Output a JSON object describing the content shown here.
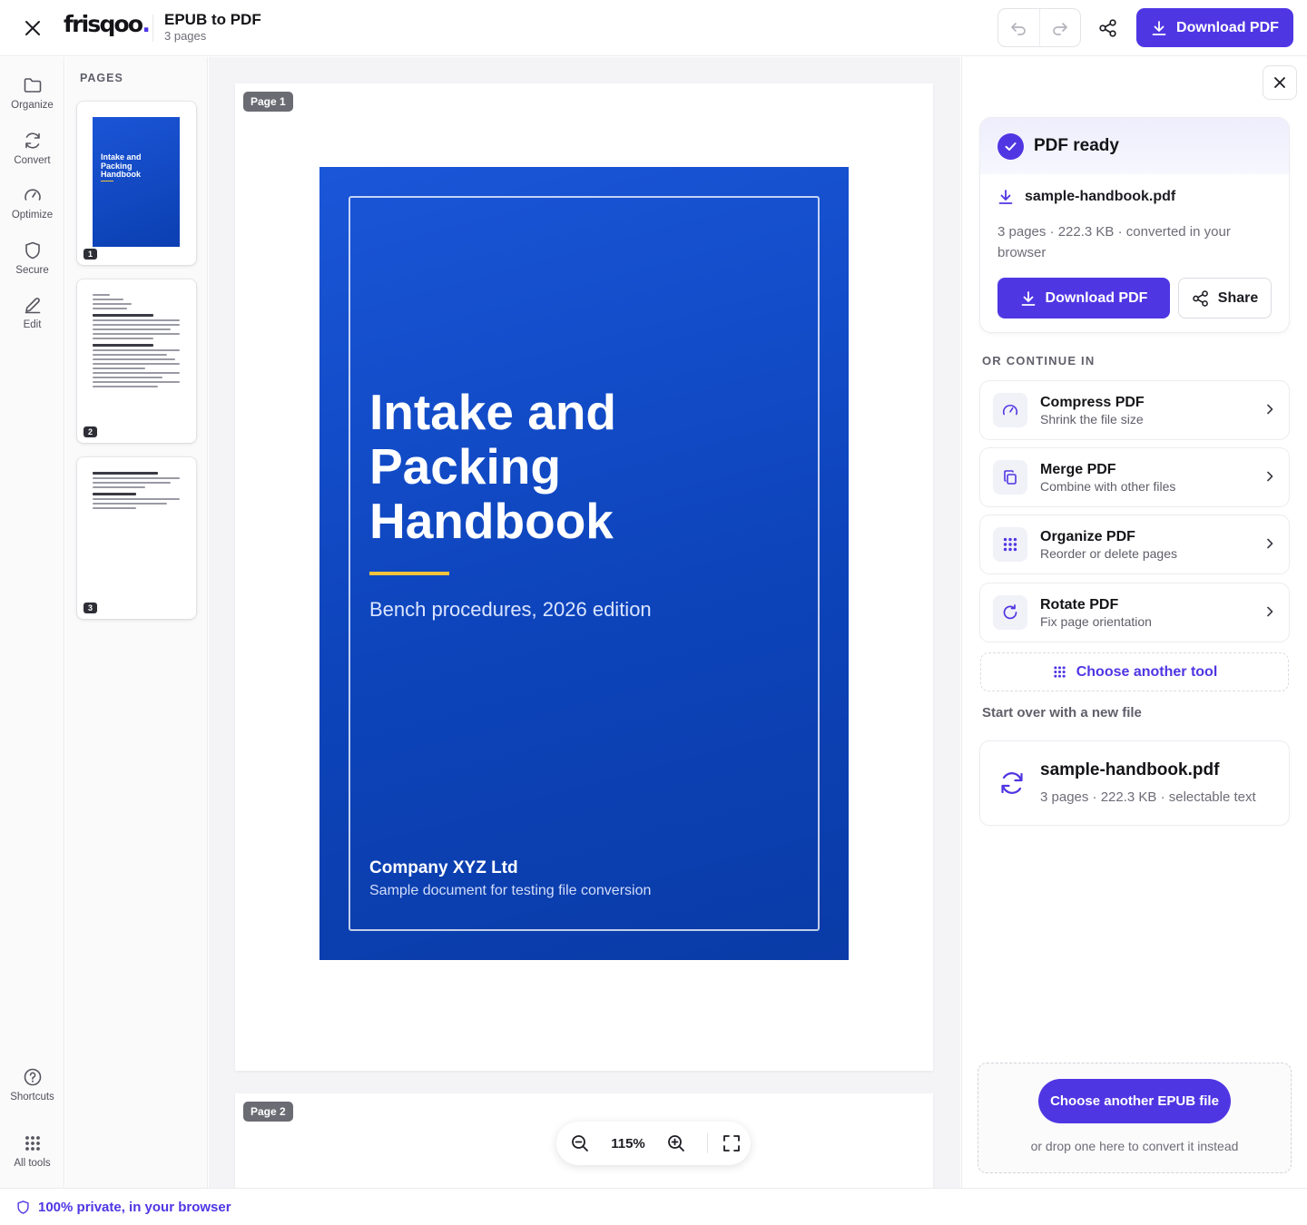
{
  "app": {
    "logo_text": "frisqoo",
    "logo_dot": ".",
    "doc_title": "EPUB to PDF",
    "doc_subtitle": "3 pages",
    "download_label": "Download PDF",
    "accent_color": "#4f36e3"
  },
  "rail": {
    "items": [
      {
        "label": "Organize",
        "icon": "folder-icon"
      },
      {
        "label": "Convert",
        "icon": "refresh-icon"
      },
      {
        "label": "Optimize",
        "icon": "gauge-icon"
      },
      {
        "label": "Secure",
        "icon": "shield-icon"
      },
      {
        "label": "Edit",
        "icon": "pencil-icon"
      }
    ],
    "bottom": [
      {
        "label": "Shortcuts",
        "icon": "help-icon"
      },
      {
        "label": "All tools",
        "icon": "grid-icon"
      }
    ]
  },
  "pages_panel": {
    "label": "PAGES",
    "thumbs": [
      {
        "num": "1",
        "cover_text": "Intake and Packing Handbook"
      },
      {
        "num": "2"
      },
      {
        "num": "3"
      }
    ]
  },
  "canvas": {
    "page1_tag": "Page 1",
    "page2_tag": "Page 2",
    "cover": {
      "title": "Intake and Packing Handbook",
      "subtitle": "Bench procedures, 2026 edition",
      "company": "Company XYZ Ltd",
      "note": "Sample document for testing file conversion"
    },
    "zoom": "115%"
  },
  "right_panel": {
    "ready_title": "PDF ready",
    "file_name": "sample-handbook.pdf",
    "file_meta": "3 pages · 222.3 KB · converted in your browser",
    "download_label": "Download PDF",
    "share_label": "Share",
    "or_continue": "OR CONTINUE IN",
    "tools": [
      {
        "name": "Compress PDF",
        "desc": "Shrink the file size",
        "icon": "gauge-icon"
      },
      {
        "name": "Merge PDF",
        "desc": "Combine with other files",
        "icon": "copy-icon"
      },
      {
        "name": "Organize PDF",
        "desc": "Reorder or delete pages",
        "icon": "grid-icon"
      },
      {
        "name": "Rotate PDF",
        "desc": "Fix page orientation",
        "icon": "rotate-icon"
      }
    ],
    "choose_tool": "Choose another tool",
    "start_over": "Start over with a new file",
    "recent_file": {
      "name": "sample-handbook.pdf",
      "meta": "3 pages · 222.3 KB · selectable text"
    },
    "drop": {
      "button": "Choose another EPUB file",
      "hint": "or drop one here to convert it instead"
    }
  },
  "footer": {
    "privacy": "100% private, in your browser"
  }
}
